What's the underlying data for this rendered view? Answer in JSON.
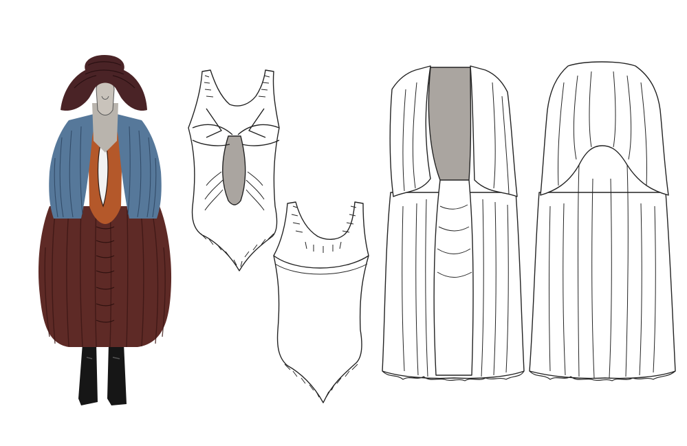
{
  "image": {
    "kind": "fashion design sheet",
    "background": "#ffffff"
  },
  "palette": {
    "hat": "#4a2326",
    "skin": "#b9b4ad",
    "wrap_blue": "#56789a",
    "bodice_orange": "#b4582a",
    "skirt_maroon": "#5e2a26",
    "boots": "#161616",
    "line": "#222222",
    "lining_grey": "#aaa5a0",
    "garment_white": "#ffffff"
  },
  "panels": [
    {
      "id": "model-illustration",
      "desc_icon": "model-figure"
    },
    {
      "id": "bodysuit-front",
      "desc_icon": "bodysuit-icon"
    },
    {
      "id": "bodysuit-back",
      "desc_icon": "bodysuit-icon"
    },
    {
      "id": "cape-front",
      "desc_icon": "cape-icon"
    },
    {
      "id": "cape-back",
      "desc_icon": "cape-icon"
    }
  ]
}
